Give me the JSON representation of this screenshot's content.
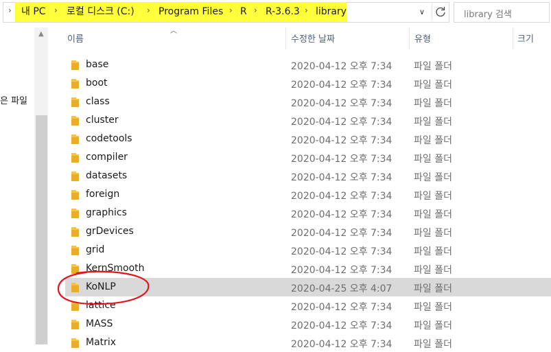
{
  "breadcrumb": {
    "items": [
      "내 PC",
      "로컬 디스크 (C:)",
      "Program Files",
      "R",
      "R-3.6.3",
      "library"
    ],
    "highlight_color": "#ffff3b"
  },
  "search": {
    "placeholder": "library 검색"
  },
  "nav": {
    "visible_text": "은 파일"
  },
  "columns": {
    "name": "이름",
    "modified": "수정한 날짜",
    "type": "유형",
    "size": "크기"
  },
  "rows": [
    {
      "name": "base",
      "modified": "2020-04-12 오후 7:34",
      "type": "파일 폴더"
    },
    {
      "name": "boot",
      "modified": "2020-04-12 오후 7:34",
      "type": "파일 폴더"
    },
    {
      "name": "class",
      "modified": "2020-04-12 오후 7:34",
      "type": "파일 폴더"
    },
    {
      "name": "cluster",
      "modified": "2020-04-12 오후 7:34",
      "type": "파일 폴더"
    },
    {
      "name": "codetools",
      "modified": "2020-04-12 오후 7:34",
      "type": "파일 폴더"
    },
    {
      "name": "compiler",
      "modified": "2020-04-12 오후 7:34",
      "type": "파일 폴더"
    },
    {
      "name": "datasets",
      "modified": "2020-04-12 오후 7:34",
      "type": "파일 폴더"
    },
    {
      "name": "foreign",
      "modified": "2020-04-12 오후 7:34",
      "type": "파일 폴더"
    },
    {
      "name": "graphics",
      "modified": "2020-04-12 오후 7:34",
      "type": "파일 폴더"
    },
    {
      "name": "grDevices",
      "modified": "2020-04-12 오후 7:34",
      "type": "파일 폴더"
    },
    {
      "name": "grid",
      "modified": "2020-04-12 오후 7:34",
      "type": "파일 폴더"
    },
    {
      "name": "KernSmooth",
      "modified": "2020-04-12 오후 7:34",
      "type": "파일 폴더"
    },
    {
      "name": "KoNLP",
      "modified": "2020-04-25 오후 4:07",
      "type": "파일 폴더",
      "selected": true
    },
    {
      "name": "lattice",
      "modified": "2020-04-12 오후 7:34",
      "type": "파일 폴더"
    },
    {
      "name": "MASS",
      "modified": "2020-04-12 오후 7:34",
      "type": "파일 폴더"
    },
    {
      "name": "Matrix",
      "modified": "2020-04-12 오후 7:34",
      "type": "파일 폴더"
    }
  ],
  "colors": {
    "selection": "#d9d9d9",
    "folder": "#f6c344",
    "annotation_circle": "#e5141b",
    "header_text": "#4d6082"
  }
}
